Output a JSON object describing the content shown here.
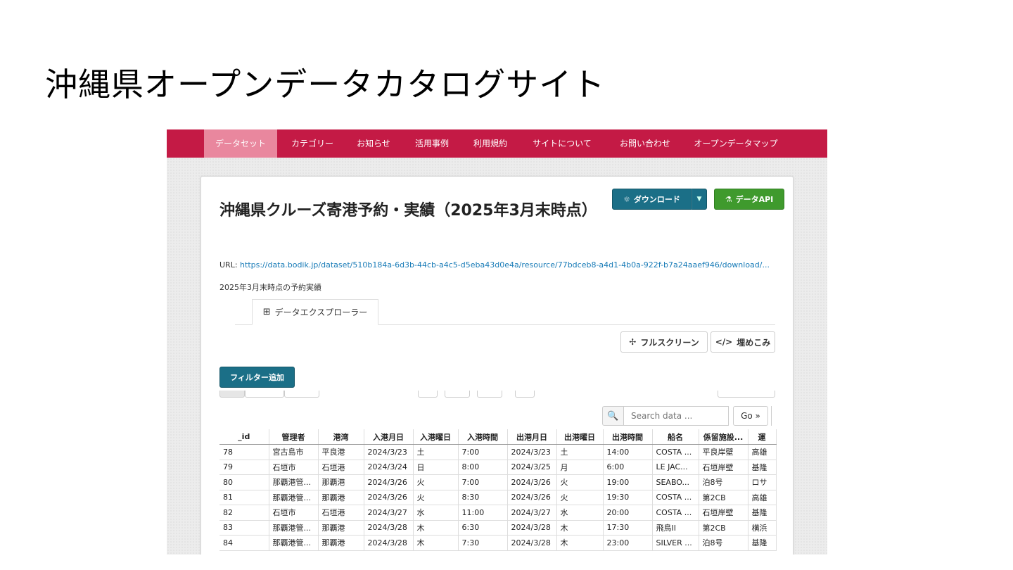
{
  "slide": {
    "title": "沖縄県オープンデータカタログサイト"
  },
  "nav": {
    "items": [
      {
        "label": "データセット",
        "active": true
      },
      {
        "label": "カテゴリー"
      },
      {
        "label": "お知らせ"
      },
      {
        "label": "活用事例"
      },
      {
        "label": "利用規約"
      },
      {
        "label": "サイトについて"
      },
      {
        "label": "お問い合わせ"
      },
      {
        "label": "オープンデータマップ"
      }
    ]
  },
  "resource": {
    "title": "沖縄県クルーズ寄港予約・実績（2025年3月末時点）",
    "download_label": "ダウンロード",
    "api_label": "データAPI",
    "url_label": "URL:",
    "url": "https://data.bodik.jp/dataset/510b184a-6d3b-44cb-a4c5-d5eba43d0e4a/resource/77bdceb8-a4d1-4b0a-922f-b7a24aaef946/download/...",
    "description": "2025年3月末時点の予約実績"
  },
  "explorer": {
    "tab_label": "データエクスプローラー",
    "fullscreen_label": "フルスクリーン",
    "embed_label": "埋めこみ",
    "filter_button": "フィルター追加",
    "search_placeholder": "Search data ...",
    "go_label": "Go »",
    "columns": [
      "_id",
      "管理者",
      "港湾",
      "入港月日",
      "入港曜日",
      "入港時間",
      "出港月日",
      "出港曜日",
      "出港時間",
      "船名",
      "係留施設...",
      "運"
    ],
    "rows": [
      [
        "78",
        "宮古島市",
        "平良港",
        "2024/3/23",
        "土",
        "7:00",
        "2024/3/23",
        "土",
        "14:00",
        "COSTA ...",
        "平良岸壁",
        "高雄"
      ],
      [
        "79",
        "石垣市",
        "石垣港",
        "2024/3/24",
        "日",
        "8:00",
        "2024/3/25",
        "月",
        "6:00",
        "LE JAC...",
        "石垣岸壁",
        "基隆"
      ],
      [
        "80",
        "那覇港管...",
        "那覇港",
        "2024/3/26",
        "火",
        "7:00",
        "2024/3/26",
        "火",
        "19:00",
        "SEABO...",
        "泊8号",
        "ロサ"
      ],
      [
        "81",
        "那覇港管...",
        "那覇港",
        "2024/3/26",
        "火",
        "8:30",
        "2024/3/26",
        "火",
        "19:30",
        "COSTA ...",
        "第2CB",
        "高雄"
      ],
      [
        "82",
        "石垣市",
        "石垣港",
        "2024/3/27",
        "水",
        "11:00",
        "2024/3/27",
        "水",
        "20:00",
        "COSTA ...",
        "石垣岸壁",
        "基隆"
      ],
      [
        "83",
        "那覇港管...",
        "那覇港",
        "2024/3/28",
        "木",
        "6:30",
        "2024/3/28",
        "木",
        "17:30",
        "飛鳥II",
        "第2CB",
        "横浜"
      ],
      [
        "84",
        "那覇港管...",
        "那覇港",
        "2024/3/28",
        "木",
        "7:30",
        "2024/3/28",
        "木",
        "23:00",
        "SILVER ...",
        "泊8号",
        "基隆"
      ]
    ]
  }
}
